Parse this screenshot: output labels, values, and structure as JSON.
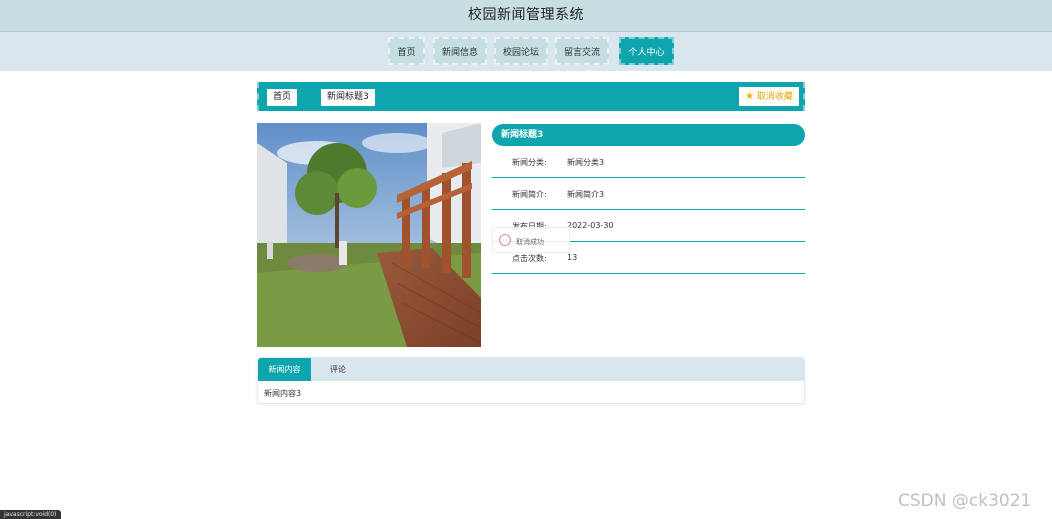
{
  "header": {
    "title": "校园新闻管理系统"
  },
  "nav": {
    "items": [
      {
        "label": "首页"
      },
      {
        "label": "新闻信息"
      },
      {
        "label": "校园论坛"
      },
      {
        "label": "留言交流"
      },
      {
        "label": "个人中心"
      }
    ],
    "active_index": 4
  },
  "breadcrumb": {
    "home": "首页",
    "current": "新闻标题3",
    "favorite_label": "取消收藏"
  },
  "detail": {
    "title": "新闻标题3",
    "rows": [
      {
        "key": "新闻分类:",
        "value": "新闻分类3"
      },
      {
        "key": "新闻简介:",
        "value": "新闻简介3"
      },
      {
        "key": "发布日期:",
        "value": "2022-03-30"
      },
      {
        "key": "点击次数:",
        "value": "13"
      }
    ]
  },
  "toast": {
    "text": "取消成功"
  },
  "tabs": {
    "items": [
      {
        "label": "新闻内容"
      },
      {
        "label": "评论"
      }
    ],
    "content": "新闻内容3"
  },
  "watermark": "CSDN @ck3021",
  "statusbar": {
    "text": "javascript:void(0)"
  },
  "colors": {
    "accent": "#0ea5ae",
    "header_bg": "#c7dfe2",
    "nav_bg": "#dae6ed",
    "favorite": "#e0a800"
  },
  "icons": {
    "favorite": "star-icon",
    "toast": "sad-face-icon"
  }
}
